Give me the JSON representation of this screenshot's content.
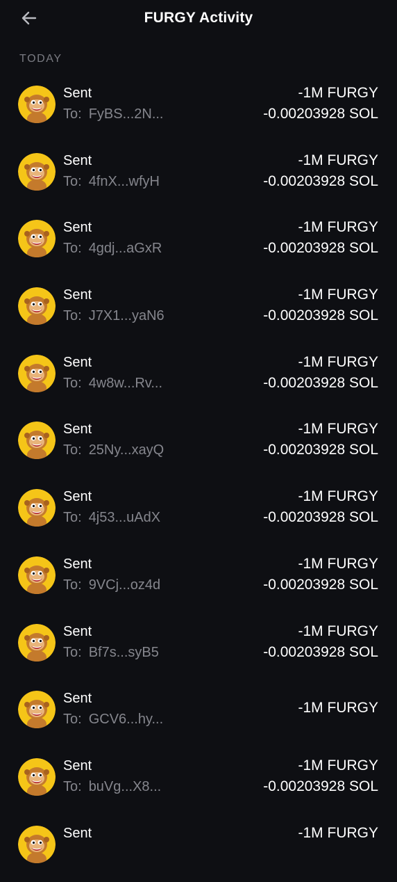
{
  "header": {
    "title": "FURGY Activity"
  },
  "section": {
    "label": "TODAY"
  },
  "colors": {
    "background": "#0e0f13",
    "secondary_text": "#85868d",
    "avatar_yellow": "#f5c518"
  },
  "transactions": [
    {
      "type": "Sent",
      "to_label": "To:",
      "to": "FyBS...2N...",
      "amount_token": "-1M FURGY",
      "amount_sol": "-0.00203928 SOL"
    },
    {
      "type": "Sent",
      "to_label": "To:",
      "to": "4fnX...wfyH",
      "amount_token": "-1M FURGY",
      "amount_sol": "-0.00203928 SOL"
    },
    {
      "type": "Sent",
      "to_label": "To:",
      "to": "4gdj...aGxR",
      "amount_token": "-1M FURGY",
      "amount_sol": "-0.00203928 SOL"
    },
    {
      "type": "Sent",
      "to_label": "To:",
      "to": "J7X1...yaN6",
      "amount_token": "-1M FURGY",
      "amount_sol": "-0.00203928 SOL"
    },
    {
      "type": "Sent",
      "to_label": "To:",
      "to": "4w8w...Rv...",
      "amount_token": "-1M FURGY",
      "amount_sol": "-0.00203928 SOL"
    },
    {
      "type": "Sent",
      "to_label": "To:",
      "to": "25Ny...xayQ",
      "amount_token": "-1M FURGY",
      "amount_sol": "-0.00203928 SOL"
    },
    {
      "type": "Sent",
      "to_label": "To:",
      "to": "4j53...uAdX",
      "amount_token": "-1M FURGY",
      "amount_sol": "-0.00203928 SOL"
    },
    {
      "type": "Sent",
      "to_label": "To:",
      "to": "9VCj...oz4d",
      "amount_token": "-1M FURGY",
      "amount_sol": "-0.00203928 SOL"
    },
    {
      "type": "Sent",
      "to_label": "To:",
      "to": "Bf7s...syB5",
      "amount_token": "-1M FURGY",
      "amount_sol": "-0.00203928 SOL"
    },
    {
      "type": "Sent",
      "to_label": "To:",
      "to": "GCV6...hy...",
      "amount_token": "-1M FURGY",
      "amount_sol": ""
    },
    {
      "type": "Sent",
      "to_label": "To:",
      "to": "buVg...X8...",
      "amount_token": "-1M FURGY",
      "amount_sol": "-0.00203928 SOL"
    },
    {
      "type": "Sent",
      "to_label": "",
      "to": "",
      "amount_token": "-1M FURGY",
      "amount_sol": ""
    }
  ]
}
